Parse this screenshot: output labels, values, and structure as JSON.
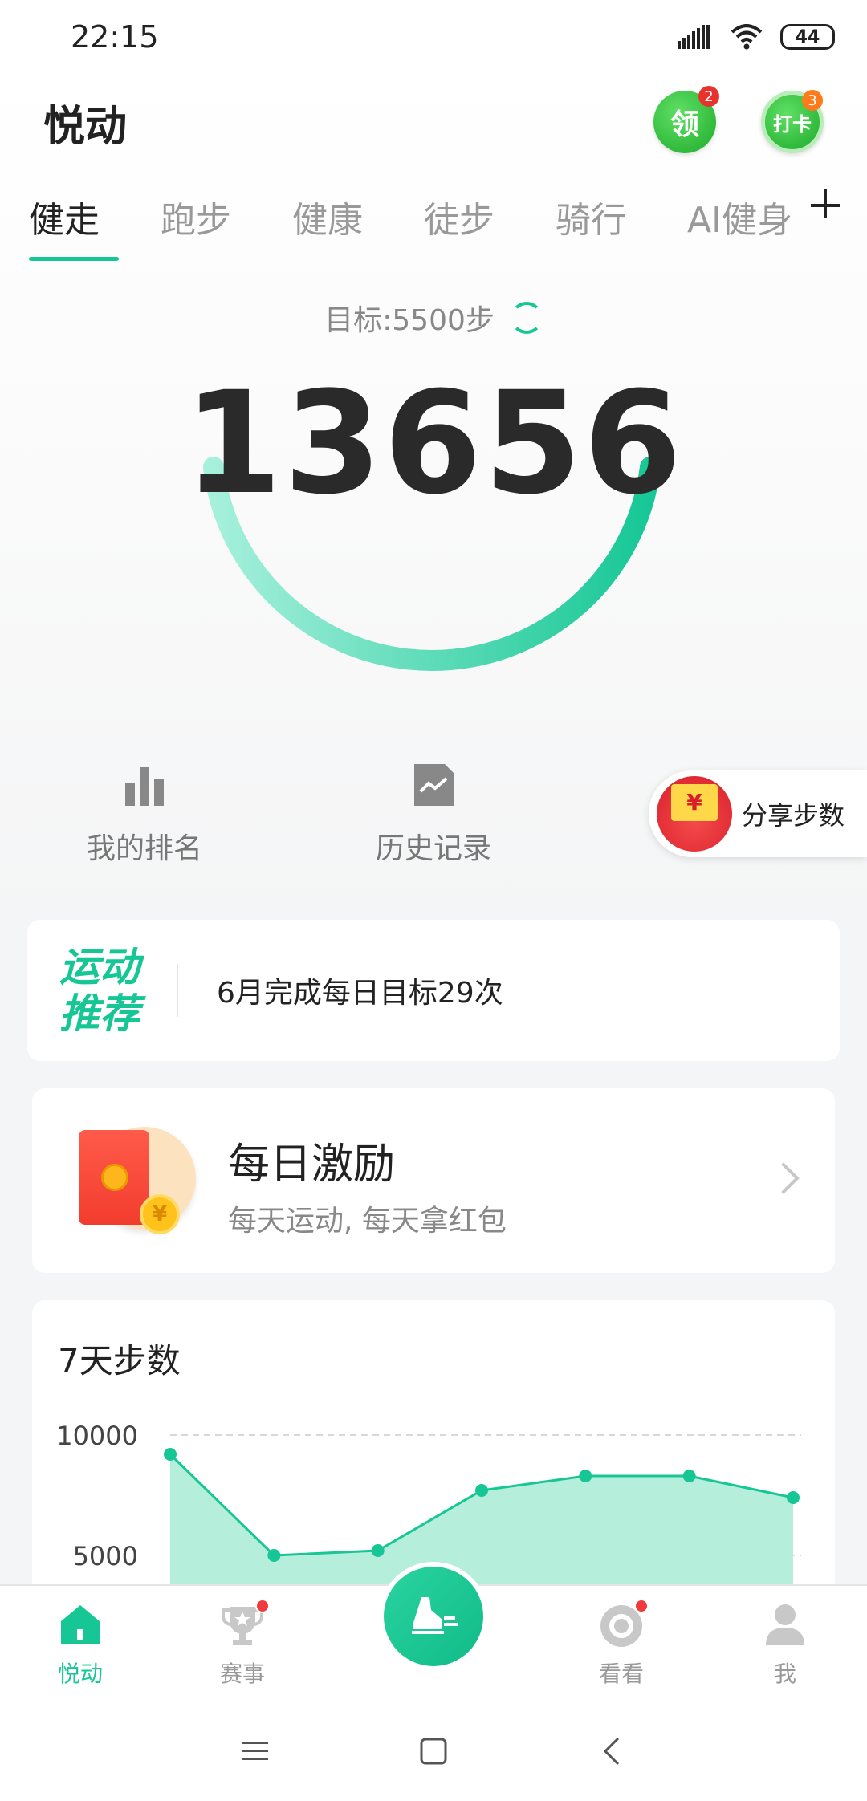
{
  "status_bar": {
    "time": "22:15",
    "battery": "44"
  },
  "header": {
    "title": "悦动",
    "collect_label": "领",
    "collect_badge": "2",
    "checkin_label": "打卡",
    "checkin_badge": "3"
  },
  "tabs": [
    {
      "label": "健走",
      "active": true
    },
    {
      "label": "跑步",
      "active": false
    },
    {
      "label": "健康",
      "active": false
    },
    {
      "label": "徒步",
      "active": false
    },
    {
      "label": "骑行",
      "active": false
    },
    {
      "label": "AI健身",
      "active": false
    }
  ],
  "steps": {
    "goal_label": "目标:5500步",
    "count": "13656",
    "progress_fraction": 1.0
  },
  "quick_actions": {
    "ranking": "我的排名",
    "history": "历史记录",
    "share": "分享步数",
    "share_coin": "¥"
  },
  "recommendation": {
    "logo_line1": "运动",
    "logo_line2": "推荐",
    "text": "6月完成每日目标29次"
  },
  "reward": {
    "title": "每日激励",
    "subtitle": "每天运动, 每天拿红包",
    "coin": "¥"
  },
  "chart": {
    "title": "7天步数"
  },
  "chart_data": {
    "type": "area",
    "title": "7天步数",
    "xlabel": "",
    "ylabel": "",
    "y_ticks": [
      10000,
      5000
    ],
    "y_tick_labels": [
      "10000",
      "5000"
    ],
    "ylim": [
      0,
      10000
    ],
    "grid": true,
    "series": [
      {
        "values": [
          9200,
          5000,
          5200,
          7700,
          8300,
          8300,
          7400
        ]
      }
    ],
    "color": "#16c795"
  },
  "bottom_nav": [
    {
      "label": "悦动",
      "active": true
    },
    {
      "label": "赛事",
      "active": false,
      "dot": true
    },
    {
      "label": "",
      "active": false
    },
    {
      "label": "看看",
      "active": false,
      "dot": true
    },
    {
      "label": "我",
      "active": false
    }
  ],
  "colors": {
    "accent": "#16c795",
    "badge_red": "#e8332c",
    "badge_orange": "#ff7a1a"
  }
}
